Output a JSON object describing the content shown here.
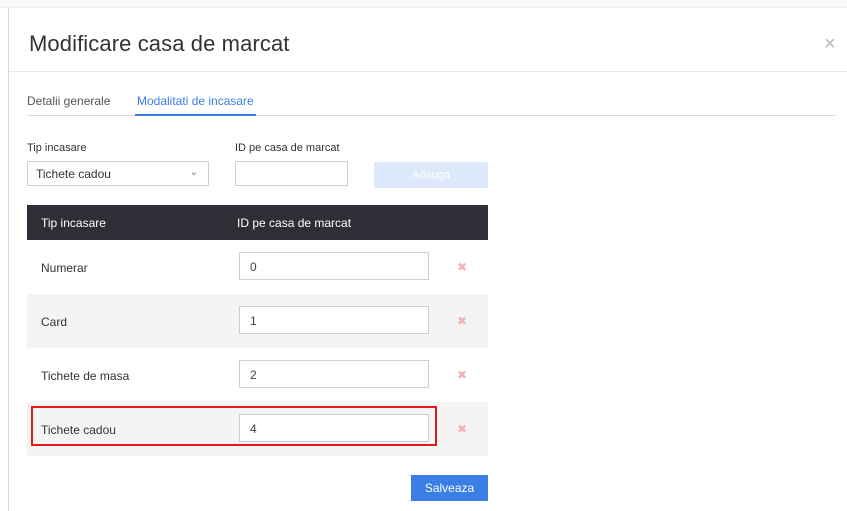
{
  "modal": {
    "title": "Modificare casa de marcat",
    "close_glyph": "×"
  },
  "tabs": [
    {
      "label": "Detalii generale",
      "active": false
    },
    {
      "label": "Modalitati de incasare",
      "active": true
    }
  ],
  "form": {
    "type_label": "Tip incasare",
    "type_value": "Tichete cadou",
    "id_label": "ID pe casa de marcat",
    "id_value": "",
    "add_label": "Adauga"
  },
  "table": {
    "headers": [
      "Tip incasare",
      "ID pe casa de marcat"
    ],
    "rows": [
      {
        "name": "Numerar",
        "id": "0"
      },
      {
        "name": "Card",
        "id": "1"
      },
      {
        "name": "Tichete de masa",
        "id": "2"
      },
      {
        "name": "Tichete cadou",
        "id": "4",
        "highlighted": true
      }
    ],
    "delete_glyph": "✖"
  },
  "footer": {
    "save_label": "Salveaza"
  },
  "colors": {
    "accent": "#3a7ee6",
    "header_bg": "#2e2e36",
    "highlight": "#e51b1b",
    "delete": "#f0b4b4"
  }
}
